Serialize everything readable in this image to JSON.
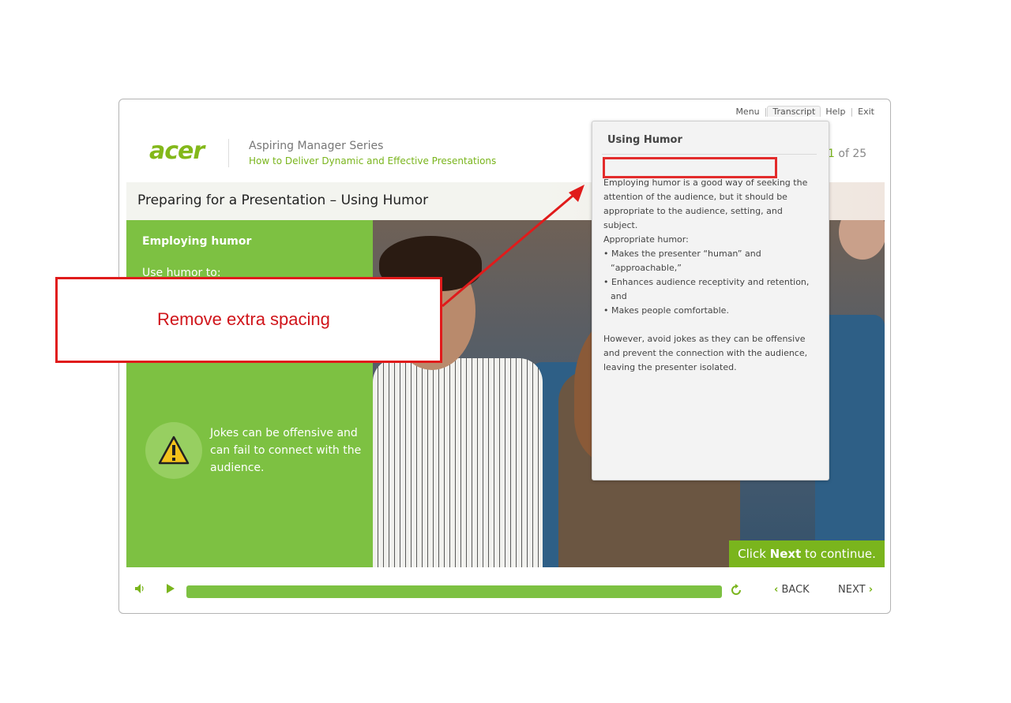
{
  "topnav": {
    "menu": "Menu",
    "transcript": "Transcript",
    "help": "Help",
    "exit": "Exit"
  },
  "header": {
    "logo": "acer",
    "series": "Aspiring Manager Series",
    "course": "How to Deliver Dynamic and Effective Presentations",
    "pager_current": "1",
    "pager_total": " of 25"
  },
  "slide": {
    "title": "Preparing for a Presentation – Using Humor",
    "panel_heading": "Employing humor",
    "panel_sub": "Use humor to:",
    "warning": "Jokes can be offensive and can fail to connect with the audience.",
    "next_banner_pre": "Click ",
    "next_banner_bold": "Next",
    "next_banner_post": " to continue."
  },
  "controls": {
    "back": "BACK",
    "next": "NEXT"
  },
  "transcript": {
    "title": "Using Humor",
    "p1": "Employing humor is a good way of seeking the attention of the audience, but it should be appropriate to the audience, setting, and subject.",
    "p2": "Appropriate humor:",
    "b1": "• Makes the presenter “human” and “approachable,”",
    "b2": "• Enhances audience receptivity and retention, and",
    "b3": "• Makes people comfortable.",
    "p3": "However, avoid jokes as they can be offensive and prevent the connection with the audience, leaving the presenter isolated."
  },
  "annotation": {
    "callout": "Remove extra spacing",
    "color": "#e01b1b"
  },
  "colors": {
    "accent": "#7dc142",
    "brand": "#83b81a"
  }
}
